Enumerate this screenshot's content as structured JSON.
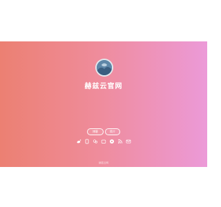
{
  "site": {
    "title": "赫兹云官网"
  },
  "buttons": [
    {
      "label": "博客"
    },
    {
      "label": "简介"
    }
  ],
  "social_icons": [
    "weibo-icon",
    "qq-icon",
    "wechat-icon",
    "bilibili-icon",
    "music-icon",
    "rss-icon",
    "mail-icon"
  ],
  "footer": {
    "icp": "赫兹云网"
  },
  "colors": {
    "gradient_start": "#ec8072",
    "gradient_mid": "#ef8c9c",
    "gradient_end": "#ec9ad8",
    "text": "#ffffff"
  }
}
